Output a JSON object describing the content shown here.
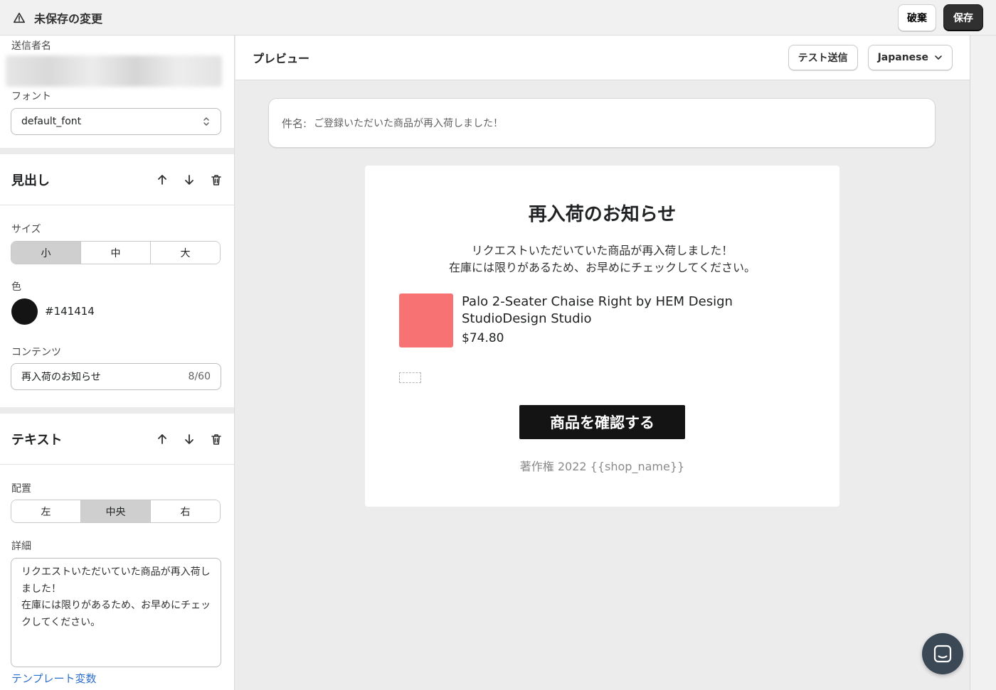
{
  "topbar": {
    "title": "未保存の変更",
    "discard_label": "破棄",
    "save_label": "保存"
  },
  "sidebar": {
    "sender_label": "送信者名",
    "font_label": "フォント",
    "font_value": "default_font",
    "heading_section": {
      "title": "見出し",
      "size_label": "サイズ",
      "size_options": [
        "小",
        "中",
        "大"
      ],
      "size_selected": "小",
      "color_label": "色",
      "color_value": "#141414",
      "content_label": "コンテンツ",
      "content_value": "再入荷のお知らせ",
      "content_count": "8/60"
    },
    "text_section": {
      "title": "テキスト",
      "align_label": "配置",
      "align_options": [
        "左",
        "中央",
        "右"
      ],
      "align_selected": "中央",
      "detail_label": "詳細",
      "detail_value": "リクエストいただいていた商品が再入荷しました！\n在庫には限りがあるため、お早めにチェックしてください。"
    },
    "template_vars_link": "テンプレート変数"
  },
  "preview": {
    "title": "プレビュー",
    "test_send_label": "テスト送信",
    "language_label": "Japanese",
    "subject_label": "件名:",
    "subject_value": "ご登録いただいた商品が再入荷しました！",
    "email": {
      "heading": "再入荷のお知らせ",
      "body": "リクエストいただいていた商品が再入荷しました！\n在庫には限りがあるため、お早めにチェックしてください。",
      "product_name": "Palo 2-Seater Chaise Right by HEM Design StudioDesign Studio",
      "product_price": "$74.80",
      "cta_label": "商品を確認する",
      "copyright": "著作権 2022 {{shop_name}}"
    }
  },
  "colors": {
    "heading_color": "#141414",
    "product_image": "#f77272",
    "link": "#2c6ecb",
    "save_button": "#303030"
  },
  "icons": {
    "warning": "warning-icon",
    "up": "arrow-up-icon",
    "down": "arrow-down-icon",
    "delete": "trash-icon",
    "select": "select-arrows-icon",
    "chevron": "chevron-down-icon",
    "chat": "chat-icon"
  }
}
